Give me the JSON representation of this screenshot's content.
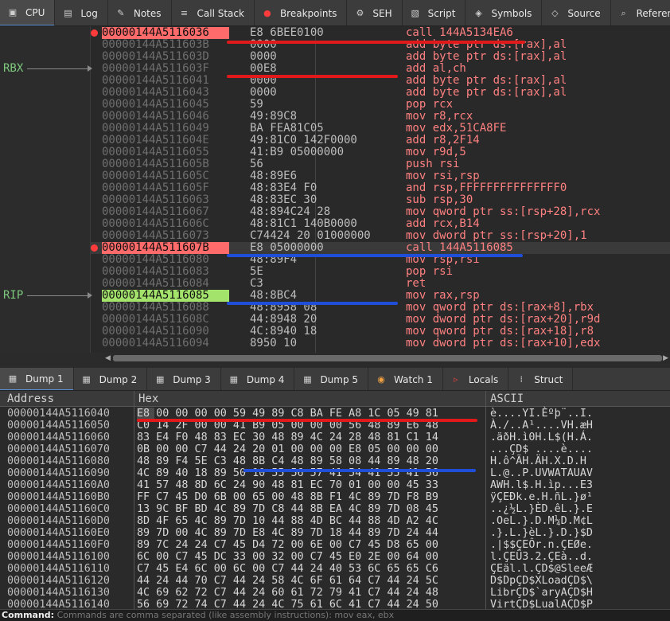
{
  "top_tabs": [
    {
      "label": "CPU",
      "icon": "cpu-icon",
      "active": true
    },
    {
      "label": "Log",
      "icon": "log-icon"
    },
    {
      "label": "Notes",
      "icon": "notes-icon"
    },
    {
      "label": "Call Stack",
      "icon": "callstack-icon"
    },
    {
      "label": "Breakpoints",
      "icon": "breakpoint-icon"
    },
    {
      "label": "SEH",
      "icon": "seh-icon"
    },
    {
      "label": "Script",
      "icon": "script-icon"
    },
    {
      "label": "Symbols",
      "icon": "symbols-icon"
    },
    {
      "label": "Source",
      "icon": "source-icon"
    },
    {
      "label": "Referen",
      "icon": "references-icon"
    }
  ],
  "registers": {
    "rbx": "RBX",
    "rip": "RIP"
  },
  "disasm": [
    {
      "addr": "00000144A5116036",
      "bytes": "E8 6BEE0100",
      "instr": "call 144A5134EA6",
      "bp": true,
      "hl": "red"
    },
    {
      "addr": "00000144A511603B",
      "bytes": "0000",
      "instr": "add byte ptr ds:[rax],al"
    },
    {
      "addr": "00000144A511603D",
      "bytes": "0000",
      "instr": "add byte ptr ds:[rax],al"
    },
    {
      "addr": "00000144A511603F",
      "bytes": "00E8",
      "instr": "add al,ch"
    },
    {
      "addr": "00000144A5116041",
      "bytes": "0000",
      "instr": "add byte ptr ds:[rax],al"
    },
    {
      "addr": "00000144A5116043",
      "bytes": "0000",
      "instr": "add byte ptr ds:[rax],al"
    },
    {
      "addr": "00000144A5116045",
      "bytes": "59",
      "instr": "pop rcx"
    },
    {
      "addr": "00000144A5116046",
      "bytes": "49:89C8",
      "instr": "mov r8,rcx"
    },
    {
      "addr": "00000144A5116049",
      "bytes": "BA FEA81C05",
      "instr": "mov edx,51CA8FE"
    },
    {
      "addr": "00000144A511604E",
      "bytes": "49:81C0 142F0000",
      "instr": "add r8,2F14"
    },
    {
      "addr": "00000144A5116055",
      "bytes": "41:B9 05000000",
      "instr": "mov r9d,5"
    },
    {
      "addr": "00000144A511605B",
      "bytes": "56",
      "instr": "push rsi"
    },
    {
      "addr": "00000144A511605C",
      "bytes": "48:89E6",
      "instr": "mov rsi,rsp"
    },
    {
      "addr": "00000144A511605F",
      "bytes": "48:83E4 F0",
      "instr": "and rsp,FFFFFFFFFFFFFFF0"
    },
    {
      "addr": "00000144A5116063",
      "bytes": "48:83EC 30",
      "instr": "sub rsp,30"
    },
    {
      "addr": "00000144A5116067",
      "bytes": "48:894C24 28",
      "instr": "mov qword ptr ss:[rsp+28],rcx"
    },
    {
      "addr": "00000144A511606C",
      "bytes": "48:81C1 140B0000",
      "instr": "add rcx,B14"
    },
    {
      "addr": "00000144A5116073",
      "bytes": "C74424 20 01000000",
      "instr": "mov dword ptr ss:[rsp+20],1"
    },
    {
      "addr": "00000144A511607B",
      "bytes": "E8 05000000",
      "instr": "call 144A5116085",
      "bp": true,
      "hl": "red",
      "selected": true
    },
    {
      "addr": "00000144A5116080",
      "bytes": "48:89F4",
      "instr": "mov rsp,rsi"
    },
    {
      "addr": "00000144A5116083",
      "bytes": "5E",
      "instr": "pop rsi"
    },
    {
      "addr": "00000144A5116084",
      "bytes": "C3",
      "instr": "ret"
    },
    {
      "addr": "00000144A5116085",
      "bytes": "48:8BC4",
      "instr": "mov rax,rsp",
      "hl": "green"
    },
    {
      "addr": "00000144A5116088",
      "bytes": "48:8958 08",
      "instr": "mov qword ptr ds:[rax+8],rbx"
    },
    {
      "addr": "00000144A511608C",
      "bytes": "44:8948 20",
      "instr": "mov dword ptr ds:[rax+20],r9d"
    },
    {
      "addr": "00000144A5116090",
      "bytes": "4C:8940 18",
      "instr": "mov qword ptr ds:[rax+18],r8"
    },
    {
      "addr": "00000144A5116094",
      "bytes": "8950 10",
      "instr": "mov dword ptr ds:[rax+10],edx"
    }
  ],
  "dump_tabs": [
    {
      "label": "Dump 1",
      "icon": "dump-icon",
      "active": true
    },
    {
      "label": "Dump 2",
      "icon": "dump-icon"
    },
    {
      "label": "Dump 3",
      "icon": "dump-icon"
    },
    {
      "label": "Dump 4",
      "icon": "dump-icon"
    },
    {
      "label": "Dump 5",
      "icon": "dump-icon"
    },
    {
      "label": "Watch 1",
      "icon": "watch-icon"
    },
    {
      "label": "Locals",
      "icon": "locals-icon"
    },
    {
      "label": "Struct",
      "icon": "struct-icon"
    }
  ],
  "dump_header": {
    "address": "Address",
    "hex": "Hex",
    "ascii": "ASCII"
  },
  "dump_rows": [
    {
      "addr": "00000144A5116040",
      "hex": "E8 00 00 00 00 59 49 89 C8 BA FE A8 1C 05 49 81",
      "ascii": "è....YI.Èºþ¨..I."
    },
    {
      "addr": "00000144A5116050",
      "hex": "C0 14 2F 00 00 41 B9 05 00 00 00 56 48 89 E6 48",
      "ascii": "À./..A¹....VH.æH"
    },
    {
      "addr": "00000144A5116060",
      "hex": "83 E4 F0 48 83 EC 30 48 89 4C 24 28 48 81 C1 14",
      "ascii": ".äðH.ì0H.L$(H.Á."
    },
    {
      "addr": "00000144A5116070",
      "hex": "0B 00 00 C7 44 24 20 01 00 00 00 E8 05 00 00 00",
      "ascii": "...ÇD$ ....è...."
    },
    {
      "addr": "00000144A5116080",
      "hex": "48 89 F4 5E C3 48 8B C4 48 89 58 08 44 89 48 20",
      "ascii": "H.ô^ÃH.ÄH.X.D.H "
    },
    {
      "addr": "00000144A5116090",
      "hex": "4C 89 40 18 89 50 10 55 56 57 41 54 41 55 41 56",
      "ascii": "L.@..P.UVWATAUAV"
    },
    {
      "addr": "00000144A51160A0",
      "hex": "41 57 48 8D 6C 24 90 48 81 EC 70 01 00 00 45 33",
      "ascii": "AWH.l$.H.ìp...E3"
    },
    {
      "addr": "00000144A51160B0",
      "hex": "FF C7 45 D0 6B 00 65 00 48 8B F1 4C 89 7D F8 B9",
      "ascii": "ÿÇEÐk.e.H.ñL.}ø¹"
    },
    {
      "addr": "00000144A51160C0",
      "hex": "13 9C BF BD 4C 89 7D C8 44 8B EA 4C 89 7D 08 45",
      "ascii": "..¿½L.}ÈD.êL.}.E"
    },
    {
      "addr": "00000144A51160D0",
      "hex": "8D 4F 65 4C 89 7D 10 44 88 4D BC 44 88 4D A2 4C",
      "ascii": ".OeL.}.D.M¼D.M¢L"
    },
    {
      "addr": "00000144A51160E0",
      "hex": "89 7D 00 4C 89 7D E8 4C 89 7D 18 44 89 7D 24 44",
      "ascii": ".}.L.}èL.}.D.}$D"
    },
    {
      "addr": "00000144A51160F0",
      "hex": "89 7C 24 24 C7 45 D4 72 00 6E 00 C7 45 D8 65 00",
      "ascii": ".|$$ÇEÔr.n.ÇEØe."
    },
    {
      "addr": "00000144A5116100",
      "hex": "6C 00 C7 45 DC 33 00 32 00 C7 45 E0 2E 00 64 00",
      "ascii": "l.ÇEÜ3.2.ÇEà..d."
    },
    {
      "addr": "00000144A5116110",
      "hex": "C7 45 E4 6C 00 6C 00 C7 44 24 40 53 6C 65 65 C6",
      "ascii": "ÇEäl.l.ÇD$@SleeÆ"
    },
    {
      "addr": "00000144A5116120",
      "hex": "44 24 44 70 C7 44 24 58 4C 6F 61 64 C7 44 24 5C",
      "ascii": "D$DpÇD$XLoadÇD$\\"
    },
    {
      "addr": "00000144A5116130",
      "hex": "4C 69 62 72 C7 44 24 60 61 72 79 41 C7 44 24 48",
      "ascii": "LibrÇD$`aryAÇD$H"
    },
    {
      "addr": "00000144A5116140",
      "hex": "56 69 72 74 C7 44 24 4C 75 61 6C 41 C7 44 24 50",
      "ascii": "VirtÇD$LualAÇD$P"
    }
  ],
  "command": {
    "label": "Command:",
    "placeholder": "Commands are comma separated (like assembly instructions): mov eax, ebx"
  },
  "colors": {
    "breakpoint": "#ff3b3b",
    "bp_addr_bg": "#ff6a6a",
    "rip_addr_bg": "#a3e26b",
    "instr": "#ff8080",
    "annotation_red": "#e01a1a",
    "annotation_blue": "#1f4fd8"
  }
}
